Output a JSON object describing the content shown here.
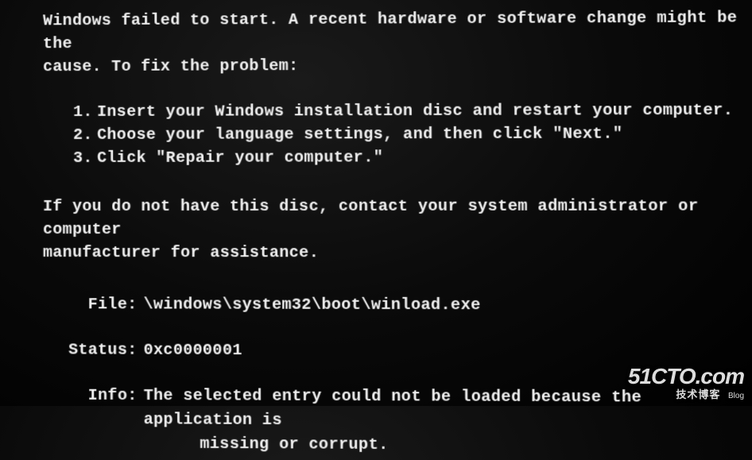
{
  "error": {
    "intro_line1": "Windows failed to start. A recent hardware or software change might be the",
    "intro_line2": "cause. To fix the problem:",
    "steps": [
      {
        "n": "1.",
        "text": "Insert your Windows installation disc and restart your computer."
      },
      {
        "n": "2.",
        "text": "Choose your language settings, and then click \"Next.\""
      },
      {
        "n": "3.",
        "text": "Click \"Repair your computer.\""
      }
    ],
    "nodisc_line1": "If you do not have this disc, contact your system administrator or computer",
    "nodisc_line2": "manufacturer for assistance.",
    "file_label": "File:",
    "file_value": "\\windows\\system32\\boot\\winload.exe",
    "status_label": "Status:",
    "status_value": "0xc0000001",
    "info_label": "Info:",
    "info_value_line1": "The selected entry could not be loaded because the application is",
    "info_value_line2": "missing or corrupt."
  },
  "watermark": {
    "brand": "51CTO.com",
    "sub_cn": "技术博客",
    "sub_en": "Blog"
  }
}
